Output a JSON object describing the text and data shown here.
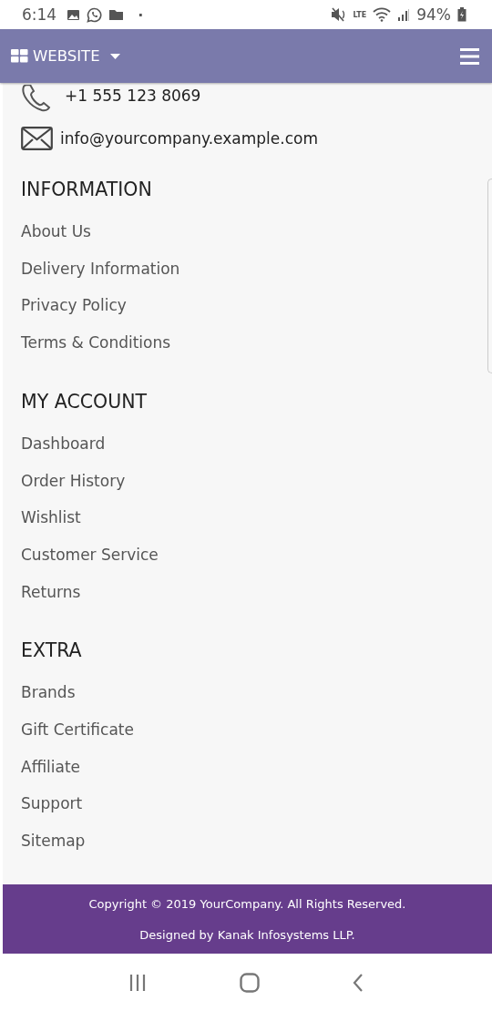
{
  "status_bar": {
    "time": "6:14",
    "dot": "·",
    "battery_percent": "94%",
    "network_label": "LTE"
  },
  "navbar": {
    "title": "WEBSITE"
  },
  "contact": {
    "phone": "+1 555 123 8069",
    "email": "info@yourcompany.example.com"
  },
  "sections": [
    {
      "title": "INFORMATION",
      "links": [
        "About Us",
        "Delivery Information",
        "Privacy Policy",
        "Terms & Conditions"
      ]
    },
    {
      "title": "MY ACCOUNT",
      "links": [
        "Dashboard",
        "Order History",
        "Wishlist",
        "Customer Service",
        "Returns"
      ]
    },
    {
      "title": "EXTRA",
      "links": [
        "Brands",
        "Gift Certificate",
        "Affiliate",
        "Support",
        "Sitemap"
      ]
    }
  ],
  "footer": {
    "copyright": "Copyright © 2019 YourCompany. All Rights Reserved.",
    "credit": "Designed by Kanak Infosystems LLP."
  }
}
